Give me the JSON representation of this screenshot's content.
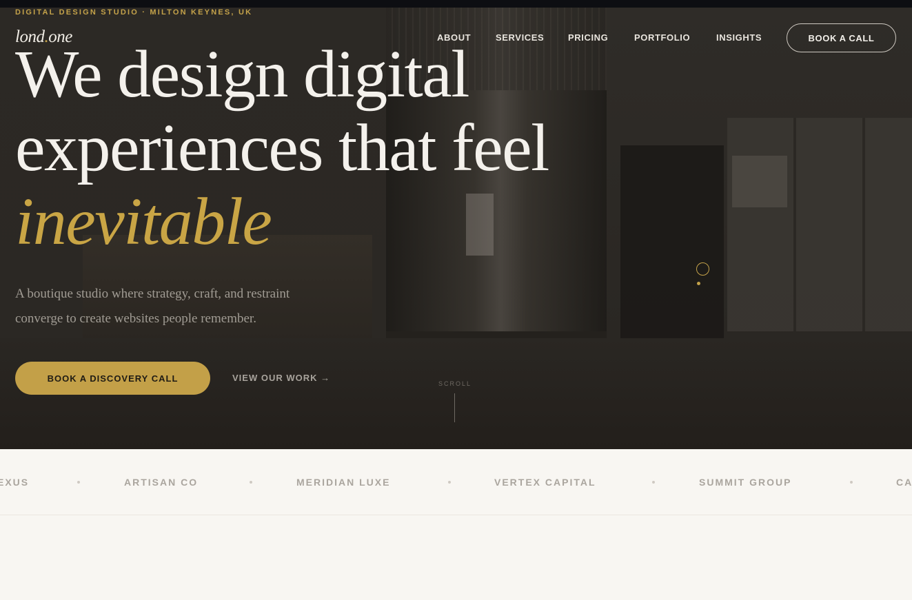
{
  "eyebrow": "DIGITAL DESIGN STUDIO · MILTON KEYNES, UK",
  "logo": {
    "name": "lond",
    "dot": ".",
    "suffix": "one"
  },
  "nav": {
    "items": [
      "ABOUT",
      "SERVICES",
      "PRICING",
      "PORTFOLIO",
      "INSIGHTS"
    ],
    "cta": "BOOK A CALL"
  },
  "hero": {
    "headline_line1": "We design digital",
    "headline_line2": "experiences that feel",
    "headline_accent": "inevitable",
    "subtitle": "A boutique studio where strategy, craft, and restraint converge to create websites people remember.",
    "primary_button": "BOOK A DISCOVERY CALL",
    "secondary_link": "VIEW OUR WORK →",
    "scroll_label": "SCROLL"
  },
  "clients": [
    "EXUS",
    "ARTISAN CO",
    "MERIDIAN LUXE",
    "VERTEX CAPITAL",
    "SUMMIT GROUP",
    "CA"
  ],
  "colors": {
    "accent": "#c4a24a",
    "hero_bg": "#25221e",
    "strip_bg": "#f8f6f2"
  }
}
